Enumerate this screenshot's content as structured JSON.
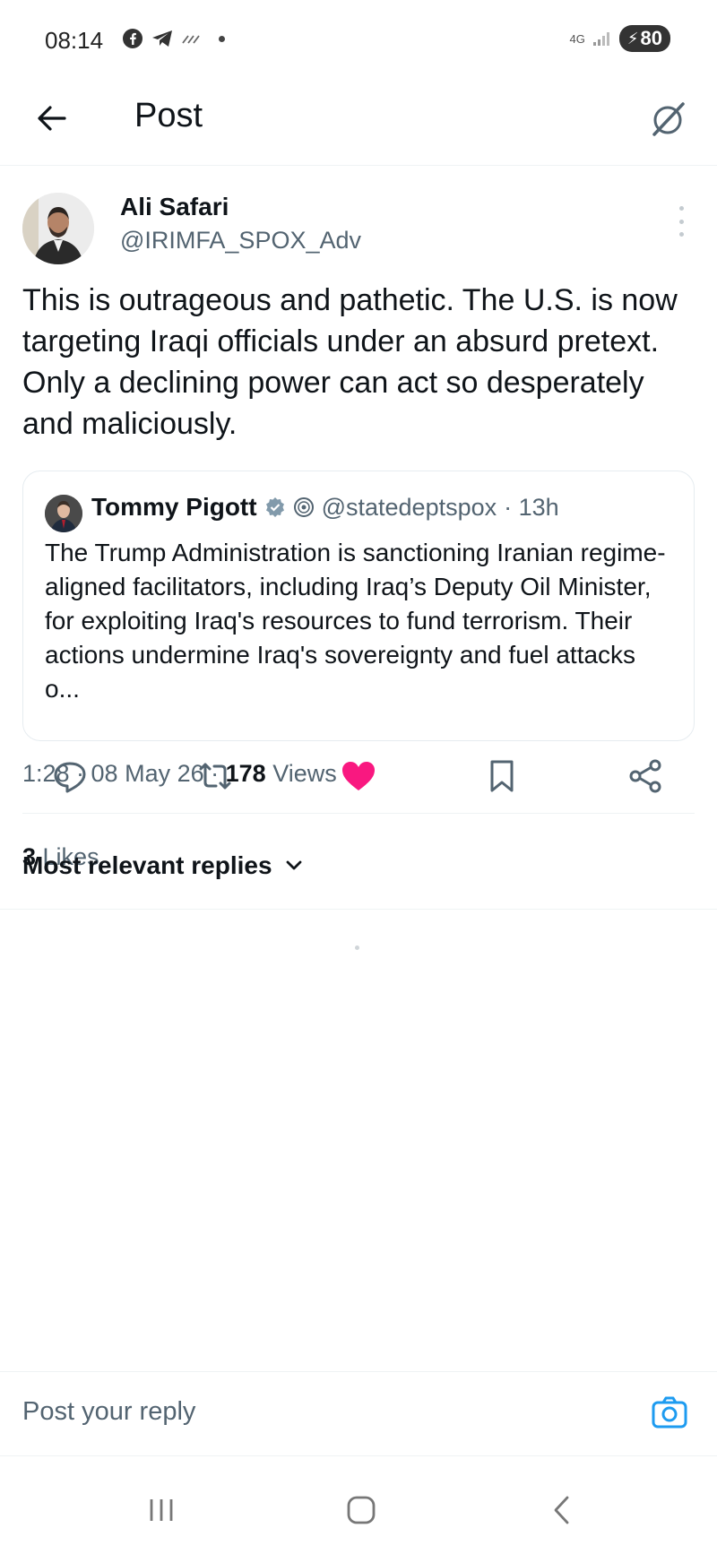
{
  "status_bar": {
    "time": "08:14",
    "network": "4G",
    "battery": "80",
    "icons": [
      "facebook-icon",
      "telegram-icon",
      "signal-icon"
    ]
  },
  "header": {
    "title": "Post",
    "back_icon": "arrow-left-icon",
    "grok_icon": "grok-icon"
  },
  "post": {
    "author_name": "Ali Safari",
    "author_handle": "@IRIMFA_SPOX_Adv",
    "text": "This is outrageous and pathetic. The U.S. is now targeting Iraqi officials under an absurd pretext. Only a declining power can act so desperately and maliciously.",
    "quote": {
      "author_name": "Tommy Pigott",
      "author_handle": "@statedeptspox",
      "time_ago": "· 13h",
      "text": "The Trump Administration is sanctioning Iranian regime-aligned facilitators, including Iraq’s Deputy Oil Minister, for exploiting Iraq's resources to fund terrorism. Their actions undermine Iraq's sovereignty and fuel attacks o..."
    },
    "timestamp": "1:28 · 08 May 26 · ",
    "views_count": "178",
    "views_label": " Views",
    "likes_count": "3",
    "likes_label": " Likes"
  },
  "actions": {
    "icons": [
      "reply-icon",
      "repost-icon",
      "like-icon",
      "bookmark-icon",
      "share-icon"
    ],
    "like_color": "#f91880"
  },
  "replies": {
    "sort_label": "Most relevant replies"
  },
  "reply_bar": {
    "placeholder": "Post your reply",
    "accent": "#1d9bf0"
  }
}
